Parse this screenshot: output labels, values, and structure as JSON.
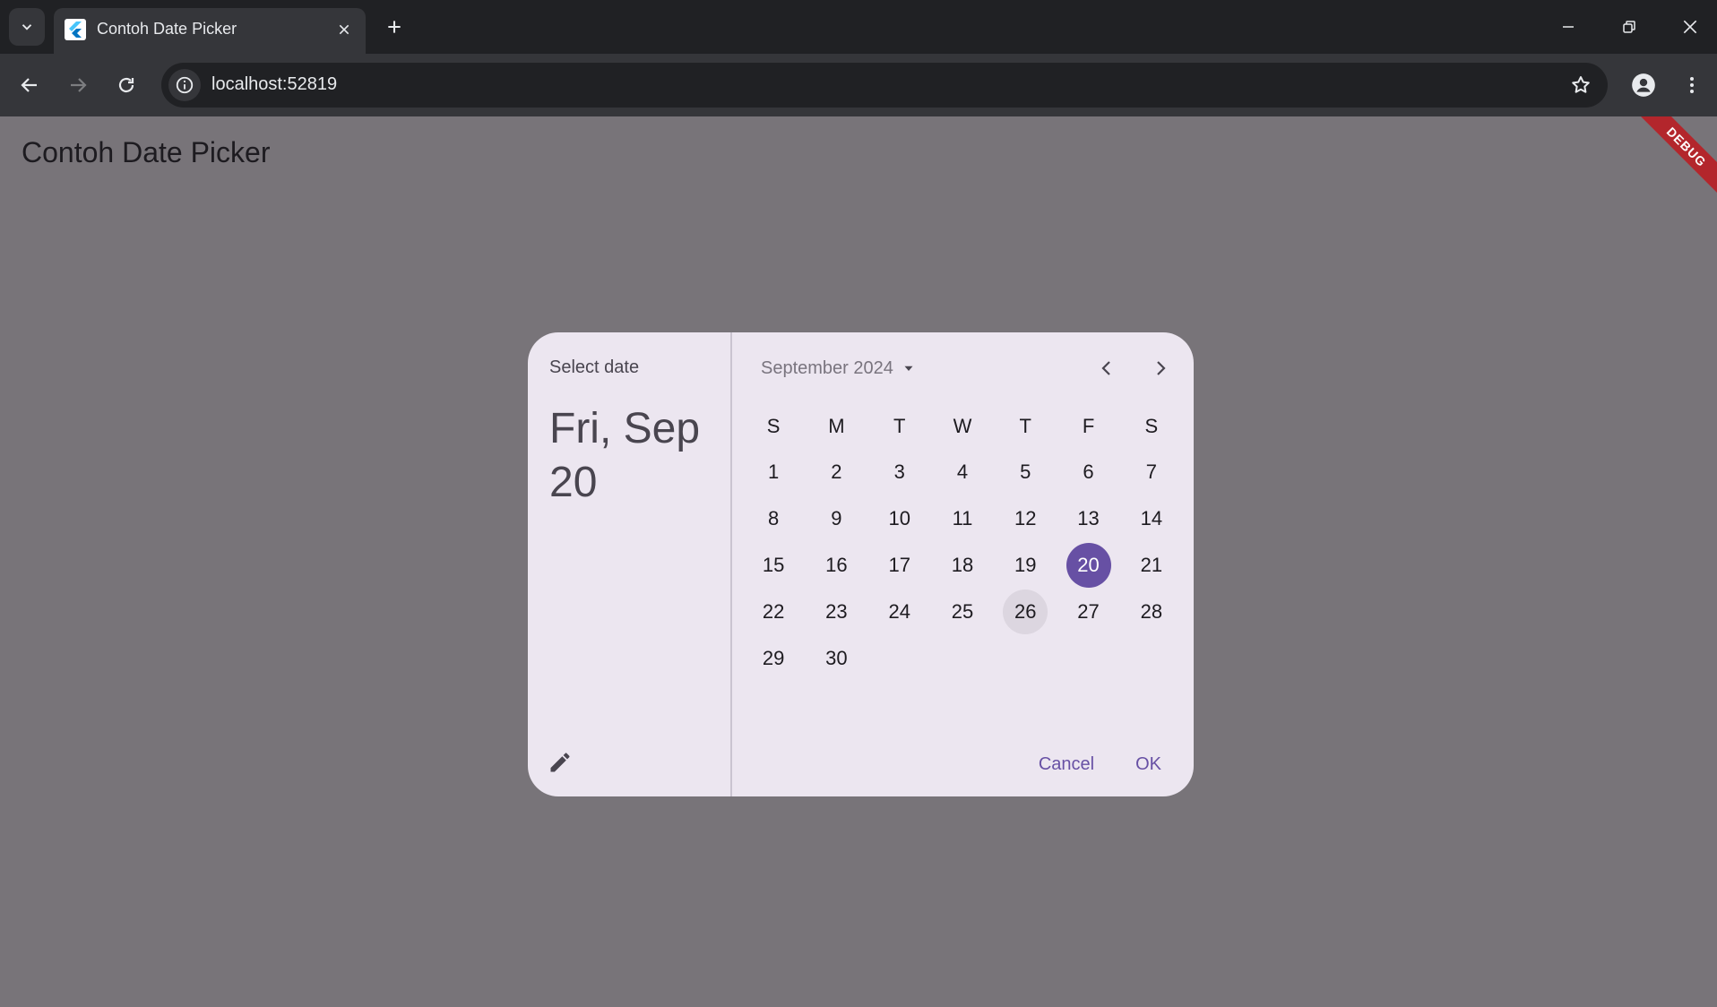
{
  "browser": {
    "tab_title": "Contoh Date Picker",
    "url": "localhost:52819"
  },
  "app": {
    "title": "Contoh Date Picker",
    "debug_label": "DEBUG"
  },
  "date_picker": {
    "help_text": "Select date",
    "headline": "Fri, Sep 20",
    "month_label": "September 2024",
    "weekdays": [
      "S",
      "M",
      "T",
      "W",
      "T",
      "F",
      "S"
    ],
    "weeks": [
      [
        "1",
        "2",
        "3",
        "4",
        "5",
        "6",
        "7"
      ],
      [
        "8",
        "9",
        "10",
        "11",
        "12",
        "13",
        "14"
      ],
      [
        "15",
        "16",
        "17",
        "18",
        "19",
        "20",
        "21"
      ],
      [
        "22",
        "23",
        "24",
        "25",
        "26",
        "27",
        "28"
      ],
      [
        "29",
        "30",
        "",
        "",
        "",
        "",
        ""
      ]
    ],
    "selected_day": "20",
    "hovered_day": "26",
    "cancel_label": "Cancel",
    "ok_label": "OK"
  },
  "colors": {
    "accent": "#6750a4",
    "dialog_surface": "#ece6f0",
    "scrim": "#787479",
    "debug_banner": "#b3262c"
  },
  "icons": [
    "chevron-down-icon",
    "flutter-favicon-icon",
    "close-icon",
    "plus-icon",
    "minimize-icon",
    "restore-icon",
    "back-arrow-icon",
    "forward-arrow-icon",
    "reload-icon",
    "info-icon",
    "star-icon",
    "profile-icon",
    "kebab-menu-icon",
    "pencil-icon",
    "dropdown-arrow-icon",
    "chevron-left-icon",
    "chevron-right-icon"
  ]
}
